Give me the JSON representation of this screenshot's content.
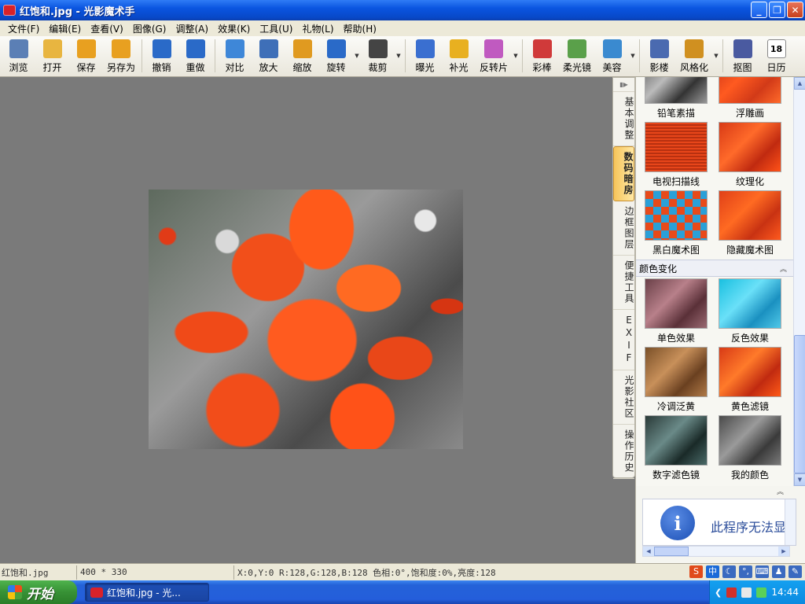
{
  "window": {
    "title": "红饱和.jpg - 光影魔术手"
  },
  "menu": [
    "文件(F)",
    "编辑(E)",
    "查看(V)",
    "图像(G)",
    "调整(A)",
    "效果(K)",
    "工具(U)",
    "礼物(L)",
    "帮助(H)"
  ],
  "toolbar": [
    {
      "label": "浏览",
      "icon": "browse-icon",
      "color": "#5b7fb5"
    },
    {
      "label": "打开",
      "icon": "open-folder-icon",
      "color": "#e8b540"
    },
    {
      "label": "保存",
      "icon": "save-icon",
      "color": "#e8a020"
    },
    {
      "label": "另存为",
      "icon": "save-as-icon",
      "color": "#e8a020"
    },
    {
      "label": "撤销",
      "icon": "undo-icon",
      "color": "#2a6ac8"
    },
    {
      "label": "重做",
      "icon": "redo-icon",
      "color": "#2a6ac8"
    },
    {
      "label": "对比",
      "icon": "compare-icon",
      "color": "#3e87d8"
    },
    {
      "label": "放大",
      "icon": "zoom-in-icon",
      "color": "#3e6fb8"
    },
    {
      "label": "缩放",
      "icon": "resize-icon",
      "color": "#e09a20"
    },
    {
      "label": "旋转",
      "icon": "rotate-icon",
      "color": "#2a6ac8"
    },
    {
      "label": "裁剪",
      "icon": "crop-icon",
      "color": "#444444"
    },
    {
      "label": "曝光",
      "icon": "exposure-icon",
      "color": "#3a6fd0"
    },
    {
      "label": "补光",
      "icon": "fill-light-icon",
      "color": "#e8b020"
    },
    {
      "label": "反转片",
      "icon": "reversal-film-icon",
      "color": "#c05ac0"
    },
    {
      "label": "彩棒",
      "icon": "color-wand-icon",
      "color": "#d03a3a"
    },
    {
      "label": "柔光镜",
      "icon": "soft-light-icon",
      "color": "#5aa04a"
    },
    {
      "label": "美容",
      "icon": "beauty-icon",
      "color": "#3a8ad0"
    },
    {
      "label": "影楼",
      "icon": "studio-icon",
      "color": "#4a6ab0"
    },
    {
      "label": "风格化",
      "icon": "stylize-icon",
      "color": "#d09020"
    },
    {
      "label": "抠图",
      "icon": "cutout-icon",
      "color": "#4a5aa0"
    },
    {
      "label": "日历",
      "icon": "calendar-icon",
      "color": "#4aa04a",
      "badge": "18"
    }
  ],
  "side_tabs": [
    "基本调整",
    "数码暗房",
    "边框图层",
    "便捷工具",
    "EXIF",
    "光影社区",
    "操作历史"
  ],
  "active_tab": "数码暗房",
  "effects": {
    "top_items": [
      "铅笔素描",
      "浮雕画",
      "电视扫描线",
      "纹理化",
      "黑白魔术图",
      "隐藏魔术图"
    ],
    "category": "颜色变化",
    "category_items": [
      "单色效果",
      "反色效果",
      "冷调泛黄",
      "黄色滤镜",
      "数字滤色镜",
      "我的颜色"
    ]
  },
  "info_widget": {
    "icon": "info-icon",
    "text": "此程序无法显"
  },
  "status": {
    "filename": "红饱和.jpg",
    "dimensions": "400 * 330",
    "pixel_info": "X:0,Y:0 R:128,G:128,B:128 色相:0°,饱和度:0%,亮度:128"
  },
  "ime": {
    "label": "中"
  },
  "taskbar": {
    "start_label": "开始",
    "task_item": "红饱和.jpg - 光...",
    "clock": "14:44"
  }
}
